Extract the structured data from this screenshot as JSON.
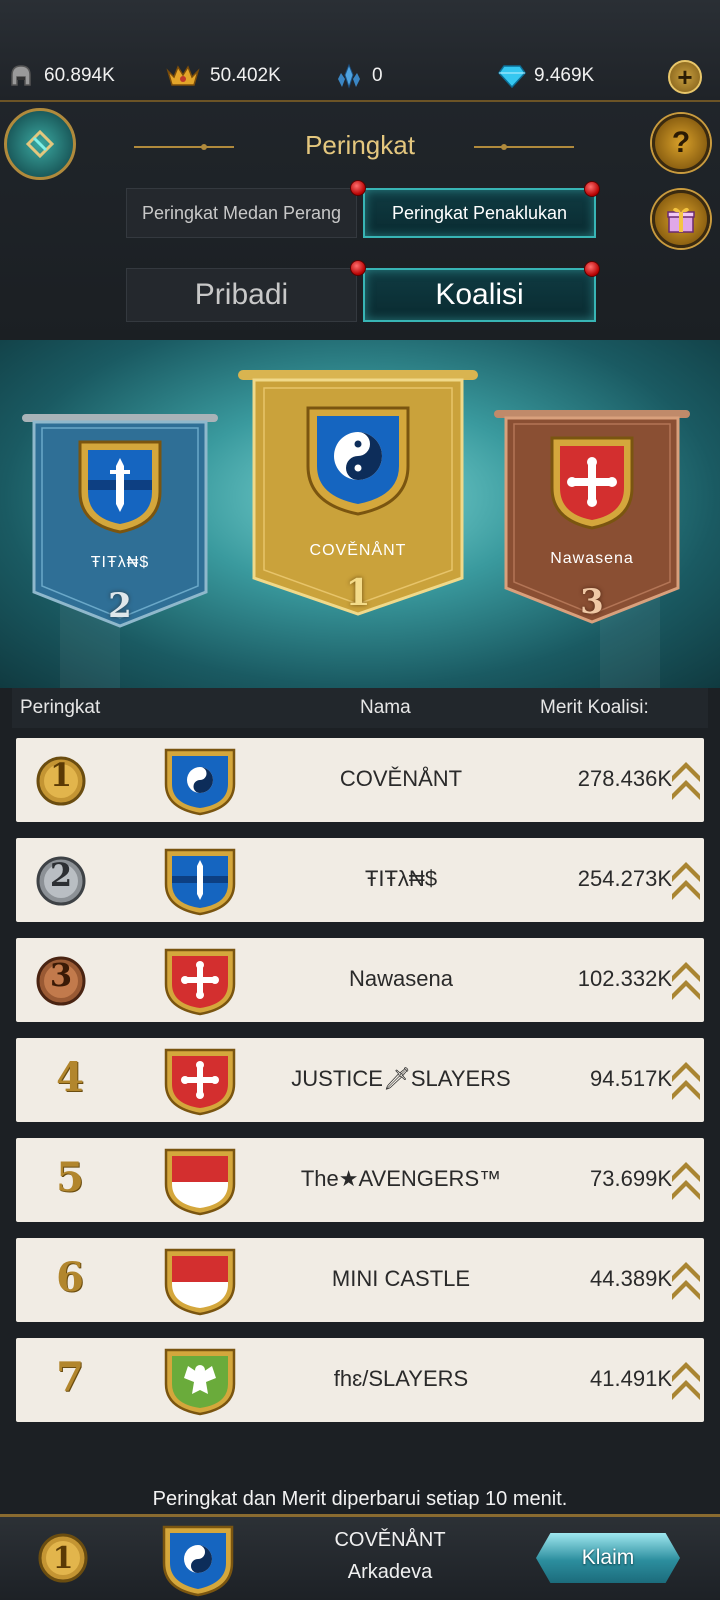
{
  "resources": [
    {
      "icon": "helmet-icon",
      "value": "60.894K"
    },
    {
      "icon": "gold-crown-icon",
      "value": "50.402K"
    },
    {
      "icon": "crystal-icon",
      "value": "0"
    },
    {
      "icon": "diamond-icon",
      "value": "9.469K"
    }
  ],
  "header": {
    "title": "Peringkat"
  },
  "tabs_primary": {
    "left": "Peringkat Medan Perang",
    "right": "Peringkat Penaklukan",
    "active": "right"
  },
  "tabs_secondary": {
    "left": "Pribadi",
    "right": "Koalisi",
    "active": "right"
  },
  "podium": [
    {
      "place": "1",
      "name": "COVĚNÅNT",
      "emblem": "yin-yang-icon"
    },
    {
      "place": "2",
      "name": "ŦIŦλ₦$",
      "emblem": "sword-icon"
    },
    {
      "place": "3",
      "name": "Nawasena",
      "emblem": "cross-fleury-icon"
    }
  ],
  "table": {
    "headers": {
      "rank": "Peringkat",
      "name": "Nama",
      "merit": "Merit Koalisi:"
    },
    "rows": [
      {
        "rank": "1",
        "name": "COVĚNÅNT",
        "merit": "278.436K",
        "emblem": "yin-yang-icon"
      },
      {
        "rank": "2",
        "name": "ŦIŦλ₦$",
        "merit": "254.273K",
        "emblem": "sword-icon"
      },
      {
        "rank": "3",
        "name": "Nawasena",
        "merit": "102.332K",
        "emblem": "cross-fleury-icon"
      },
      {
        "rank": "4",
        "name": "JUSTICE🗡SLAYERS",
        "merit": "94.517K",
        "emblem": "cross-fleury-icon"
      },
      {
        "rank": "5",
        "name": "The★AVENGERS™",
        "merit": "73.699K",
        "emblem": "red-white-flag-icon"
      },
      {
        "rank": "6",
        "name": "MINI CASTLE",
        "merit": "44.389K",
        "emblem": "red-white-flag-icon"
      },
      {
        "rank": "7",
        "name": "fhɛ/SLAYERS",
        "merit": "41.491K",
        "emblem": "eagle-icon"
      }
    ]
  },
  "notice": "Peringkat dan Merit diperbarui setiap 10 menit.",
  "footer": {
    "rank": "1",
    "coalition": "COVĚNÅNT",
    "player": "Arkadeva",
    "claim_label": "Klaim"
  },
  "colors": {
    "gold": "#b2862d",
    "teal_active": "#38b5b5",
    "row_bg": "#f1ece4",
    "shield_blue": "#1565c0",
    "shield_red": "#d32f2f",
    "shield_green": "#6aab3b"
  }
}
